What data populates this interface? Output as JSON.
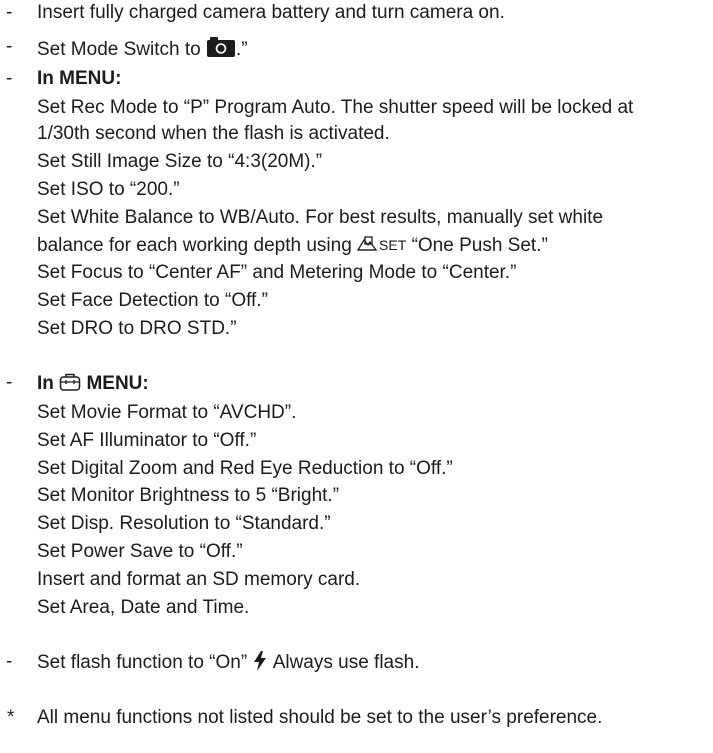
{
  "bullets": {
    "dash": "-",
    "star": "*"
  },
  "steps": {
    "battery": "Insert fully charged camera battery and turn camera on.",
    "mode_switch_prefix": "Set Mode Switch to",
    "mode_switch_suffix": ".”",
    "menu1_header_prefix": "In ",
    "menu1_header_suffix": "MENU:",
    "menu1_items": [
      "Set Rec Mode to “P” Program Auto. The shutter speed will be locked at",
      "1/30th second when the flash is activated.",
      "Set Still Image Size to “4:3(20M).”",
      "Set ISO to “200.”",
      "Set White Balance to WB/Auto. For best results, manually set white"
    ],
    "wb_line_prefix": "balance for each working depth using",
    "wb_icon_set_text": "SET",
    "wb_line_suffix": "“One Push Set.”",
    "menu1_items_after": [
      "Set Focus to “Center AF” and Metering Mode to “Center.”",
      "Set Face Detection to “Off.”",
      "Set DRO to DRO STD.”"
    ],
    "menu2_header_prefix": "In",
    "menu2_header_suffix": "MENU:",
    "menu2_items": [
      "Set Movie Format to “AVCHD”.",
      "Set  AF Illuminator to “Off.”",
      "Set Digital Zoom and Red Eye Reduction to “Off.”",
      "Set Monitor Brightness to 5 “Bright.”",
      "Set Disp. Resolution to “Standard.”",
      "Set Power Save to “Off.”",
      "Insert and format an SD memory card.",
      "Set Area, Date and Time."
    ],
    "flash_prefix": "Set flash function to “On”",
    "flash_suffix": "Always use flash.",
    "footnote": "All menu functions not listed should be set to the user’s preference."
  },
  "icons": {
    "mode_switch": "camera-icon",
    "menu1": "camera-icon",
    "wb": "white-balance-set-icon",
    "menu2": "toolbox-icon",
    "flash": "flash-bolt-icon"
  }
}
